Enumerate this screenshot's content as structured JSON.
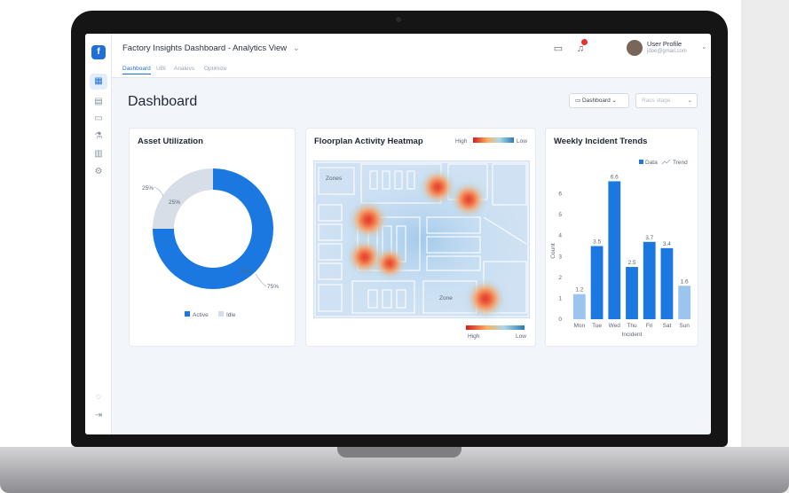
{
  "app": {
    "title": "Factory Insights Dashboard - Analytics View",
    "title_chevron": "⌄",
    "logo_glyph": "f"
  },
  "header": {
    "user_name": "User Profile",
    "user_email": "jdoe@gmail.com",
    "chevron": "⌄"
  },
  "tabs": [
    {
      "label": "Dashboard"
    },
    {
      "label": "UBI"
    },
    {
      "label": "Analevs"
    },
    {
      "label": "Optimize"
    }
  ],
  "page": {
    "title": "Dashboard",
    "view_dropdown": "Dashboard ⌄",
    "stage_dropdown": "Rass stage",
    "stage_chevron": "⌄"
  },
  "sidebar_icons": [
    "grid-icon",
    "chart-icon",
    "calendar-icon",
    "flask-icon",
    "bar-chart-icon",
    "gear-icon",
    "help-icon",
    "logout-icon"
  ],
  "asset_utilization": {
    "title": "Asset Utilization",
    "legend_active": "Active",
    "legend_idle": "Idle",
    "active_color": "#1a78e0",
    "idle_color": "#d7dee8",
    "chart_data": {
      "type": "pie",
      "categories": [
        "Active",
        "Idle"
      ],
      "values": [
        75,
        25
      ],
      "labels_outer": [
        "25%",
        "75%"
      ],
      "labels_inner": [
        "25%",
        "75%"
      ]
    }
  },
  "heatmap": {
    "title": "Floorplan Activity Heatmap",
    "legend_high": "High",
    "legend_low": "Low",
    "zone_label_1": "Zones",
    "zone_label_2": "Zone"
  },
  "incidents": {
    "title": "Weekly Incident Trends",
    "legend_data": "Data",
    "legend_trend": "Trend",
    "bar_color": "#1a78e0",
    "bar_light_color": "#9bc4ef",
    "chart_data": {
      "type": "bar",
      "categories": [
        "Mon",
        "Tue",
        "Wed",
        "Thu",
        "Fri",
        "Sat",
        "Sun"
      ],
      "values": [
        1.2,
        3.5,
        6.6,
        2.5,
        3.7,
        3.4,
        1.6
      ],
      "value_labels": [
        "1.2",
        "3.5",
        "6.6",
        "2.5",
        "3.7",
        "3.4",
        "1.6"
      ],
      "yticks": [
        "0",
        "1",
        "2",
        "3",
        "4",
        "5",
        "6"
      ],
      "ylim": [
        0,
        7
      ],
      "xlabel": "Incident",
      "ylabel": "Count"
    }
  }
}
